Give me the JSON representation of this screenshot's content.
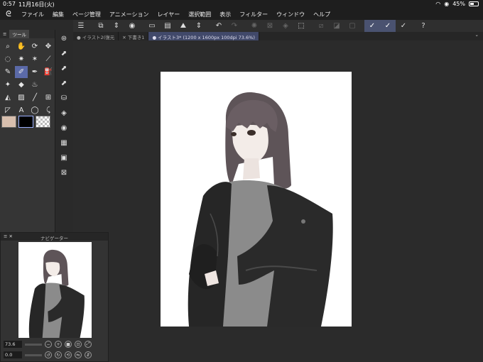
{
  "status": {
    "time": "0:57",
    "date": "11月16日(火)",
    "battery": "45%"
  },
  "menu": {
    "logo": "ᘓ",
    "items": [
      "ファイル",
      "編集",
      "ページ管理",
      "アニメーション",
      "レイヤー",
      "選択範囲",
      "表示",
      "フィルター",
      "ウィンドウ",
      "ヘルプ"
    ]
  },
  "toolbar": {
    "icons": [
      {
        "name": "menu-icon",
        "glyph": "☰",
        "state": ""
      },
      {
        "name": "sep",
        "glyph": "",
        "state": "sep"
      },
      {
        "name": "new-canvas-icon",
        "glyph": "⧉",
        "state": ""
      },
      {
        "name": "sort-icon",
        "glyph": "⇕",
        "state": ""
      },
      {
        "name": "record-icon",
        "glyph": "◉",
        "state": ""
      },
      {
        "name": "sep",
        "glyph": "",
        "state": "sep"
      },
      {
        "name": "new-file-icon",
        "glyph": "▭",
        "state": ""
      },
      {
        "name": "open-folder-icon",
        "glyph": "▤",
        "state": ""
      },
      {
        "name": "save-icon",
        "glyph": "⛰",
        "state": ""
      },
      {
        "name": "save-options-icon",
        "glyph": "⇕",
        "state": ""
      },
      {
        "name": "sep",
        "glyph": "",
        "state": "sep"
      },
      {
        "name": "undo-icon",
        "glyph": "↶",
        "state": ""
      },
      {
        "name": "redo-icon",
        "glyph": "↷",
        "state": "dim"
      },
      {
        "name": "sep",
        "glyph": "",
        "state": "sep"
      },
      {
        "name": "loading-icon",
        "glyph": "✺",
        "state": "dim"
      },
      {
        "name": "clear-icon",
        "glyph": "⊠",
        "state": "dim"
      },
      {
        "name": "fill-icon",
        "glyph": "◈",
        "state": "dim"
      },
      {
        "name": "transform-icon",
        "glyph": "⬚",
        "state": ""
      },
      {
        "name": "sep",
        "glyph": "",
        "state": "sep"
      },
      {
        "name": "deselect-icon",
        "glyph": "⧄",
        "state": "dim"
      },
      {
        "name": "invert-icon",
        "glyph": "◪",
        "state": "dim"
      },
      {
        "name": "selection-border-icon",
        "glyph": "▢",
        "state": "dim"
      },
      {
        "name": "sep",
        "glyph": "",
        "state": "sep"
      },
      {
        "name": "snap-ruler-icon",
        "glyph": "✓",
        "state": "active"
      },
      {
        "name": "snap-special-icon",
        "glyph": "✓",
        "state": "active"
      },
      {
        "name": "snap-grid-icon",
        "glyph": "✓",
        "state": ""
      },
      {
        "name": "sep",
        "glyph": "",
        "state": "sep"
      },
      {
        "name": "help-icon",
        "glyph": "?",
        "state": ""
      }
    ]
  },
  "tabs": {
    "items": [
      {
        "label": "● イラスト2(復元",
        "active": false
      },
      {
        "label": "✕ 下書き1",
        "active": false
      },
      {
        "label": "● イラスト3* (1200 x 1600px 100dpi 73.6%)",
        "active": true
      }
    ],
    "expand": "⌄"
  },
  "toolpanel": {
    "tab_label": "ツール",
    "tools": [
      {
        "name": "zoom-tool-icon",
        "glyph": "⌕"
      },
      {
        "name": "hand-tool-icon",
        "glyph": "✋"
      },
      {
        "name": "rotate-tool-icon",
        "glyph": "⟳"
      },
      {
        "name": "move-tool-icon",
        "glyph": "✥"
      },
      {
        "name": "lasso-tool-icon",
        "glyph": "◌"
      },
      {
        "name": "magic-wand-tool-icon",
        "glyph": "✷"
      },
      {
        "name": "auto-select-tool-icon",
        "glyph": "✶"
      },
      {
        "name": "eyedropper-tool-icon",
        "glyph": "⟋"
      },
      {
        "name": "pen-tool-icon",
        "glyph": "✎"
      },
      {
        "name": "pencil-tool-icon",
        "glyph": "✐"
      },
      {
        "name": "brush-tool-icon",
        "glyph": "✒"
      },
      {
        "name": "airbrush-tool-icon",
        "glyph": "⛽"
      },
      {
        "name": "decoration-tool-icon",
        "glyph": "✦"
      },
      {
        "name": "eraser-tool-icon",
        "glyph": "◆"
      },
      {
        "name": "blend-tool-icon",
        "glyph": "♨"
      },
      {
        "name": "empty-slot",
        "glyph": ""
      },
      {
        "name": "fill-tool-icon",
        "glyph": "◭"
      },
      {
        "name": "gradient-tool-icon",
        "glyph": "▨"
      },
      {
        "name": "figure-tool-icon",
        "glyph": "╱"
      },
      {
        "name": "frame-tool-icon",
        "glyph": "⊞"
      },
      {
        "name": "ruler-tool-icon",
        "glyph": "◸"
      },
      {
        "name": "text-tool-icon",
        "glyph": "A"
      },
      {
        "name": "balloon-tool-icon",
        "glyph": "◯"
      },
      {
        "name": "correct-line-tool-icon",
        "glyph": "⤹"
      }
    ]
  },
  "iconstrip": [
    {
      "name": "navigator-icon",
      "glyph": "⊛"
    },
    {
      "name": "sub-tool-icon",
      "glyph": "⬈"
    },
    {
      "name": "tool-property-icon",
      "glyph": "⬈"
    },
    {
      "name": "brush-size-icon",
      "glyph": "⬈"
    },
    {
      "name": "color-set-icon",
      "glyph": "⛁"
    },
    {
      "name": "layer-icon",
      "glyph": "◈"
    },
    {
      "name": "color-history-icon",
      "glyph": "◉"
    },
    {
      "name": "material-icon",
      "glyph": "▦"
    },
    {
      "name": "layer-property-icon",
      "glyph": "▣"
    },
    {
      "name": "quick-access-icon",
      "glyph": "⊠"
    }
  ],
  "navigator": {
    "title": "ナビゲーター",
    "zoom_value": "73.6",
    "rotate_value": "0.0"
  },
  "colors": {
    "main_color": "#d8bfae",
    "sub_color": "#000000",
    "accent": "#5b6aa8"
  }
}
